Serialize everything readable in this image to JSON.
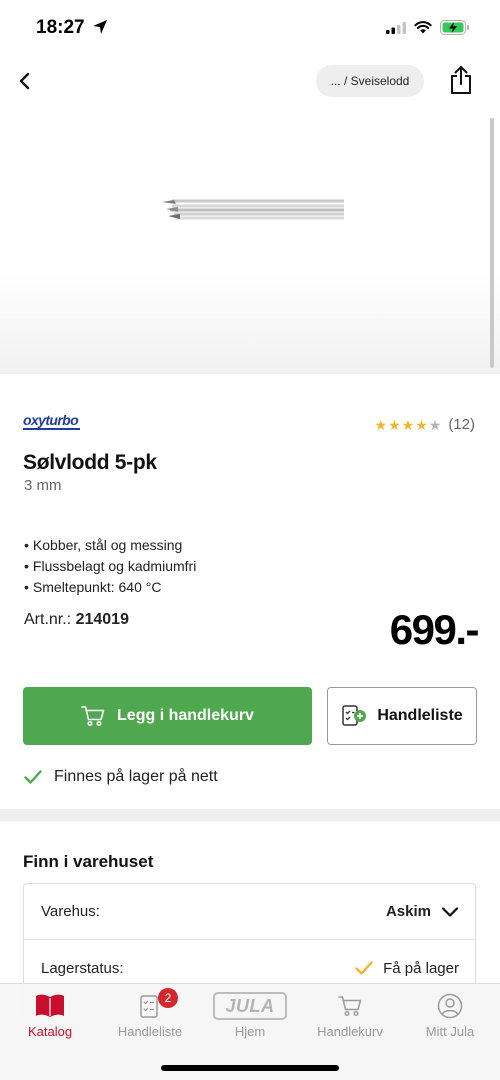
{
  "status_bar": {
    "time": "18:27"
  },
  "nav": {
    "breadcrumb": "... / Sveiselodd"
  },
  "product": {
    "brand": "oxyturbo",
    "rating": 4,
    "rating_max": 5,
    "rating_count": "(12)",
    "title": "Sølvlodd 5-pk",
    "subtitle": "3 mm",
    "features": [
      "Kobber, stål og messing",
      "Flussbelagt og kadmiumfri",
      "Smeltepunkt: 640 °C"
    ],
    "artnr_label": "Art.nr.:",
    "artnr_value": "214019",
    "price": "699.-"
  },
  "actions": {
    "add_to_cart": "Legg i handlekurv",
    "shopping_list": "Handleliste"
  },
  "availability": {
    "online": "Finnes på lager på nett"
  },
  "store_finder": {
    "title": "Finn i varehuset",
    "warehouse_label": "Varehus:",
    "warehouse_value": "Askim",
    "stock_label": "Lagerstatus:",
    "stock_value": "Få på lager"
  },
  "tabs": [
    {
      "label": "Katalog",
      "active": true
    },
    {
      "label": "Handleliste",
      "badge": "2"
    },
    {
      "label": "Hjem",
      "logo_text": "JULA"
    },
    {
      "label": "Handlekurv"
    },
    {
      "label": "Mitt Jula"
    }
  ],
  "colors": {
    "primary_green": "#4fa84f",
    "accent_red": "#c8102e",
    "star_yellow": "#f2b52e",
    "brand_blue": "#1f3f97"
  }
}
